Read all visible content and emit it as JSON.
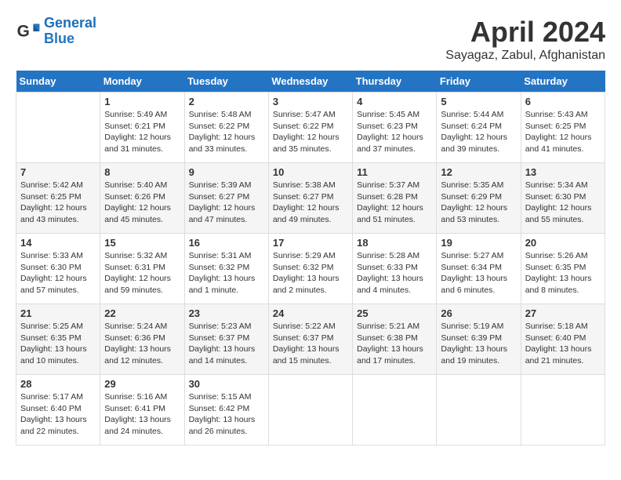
{
  "header": {
    "logo_line1": "General",
    "logo_line2": "Blue",
    "month_year": "April 2024",
    "location": "Sayagaz, Zabul, Afghanistan"
  },
  "weekdays": [
    "Sunday",
    "Monday",
    "Tuesday",
    "Wednesday",
    "Thursday",
    "Friday",
    "Saturday"
  ],
  "weeks": [
    [
      {
        "day": "",
        "info": ""
      },
      {
        "day": "1",
        "info": "Sunrise: 5:49 AM\nSunset: 6:21 PM\nDaylight: 12 hours\nand 31 minutes."
      },
      {
        "day": "2",
        "info": "Sunrise: 5:48 AM\nSunset: 6:22 PM\nDaylight: 12 hours\nand 33 minutes."
      },
      {
        "day": "3",
        "info": "Sunrise: 5:47 AM\nSunset: 6:22 PM\nDaylight: 12 hours\nand 35 minutes."
      },
      {
        "day": "4",
        "info": "Sunrise: 5:45 AM\nSunset: 6:23 PM\nDaylight: 12 hours\nand 37 minutes."
      },
      {
        "day": "5",
        "info": "Sunrise: 5:44 AM\nSunset: 6:24 PM\nDaylight: 12 hours\nand 39 minutes."
      },
      {
        "day": "6",
        "info": "Sunrise: 5:43 AM\nSunset: 6:25 PM\nDaylight: 12 hours\nand 41 minutes."
      }
    ],
    [
      {
        "day": "7",
        "info": "Sunrise: 5:42 AM\nSunset: 6:25 PM\nDaylight: 12 hours\nand 43 minutes."
      },
      {
        "day": "8",
        "info": "Sunrise: 5:40 AM\nSunset: 6:26 PM\nDaylight: 12 hours\nand 45 minutes."
      },
      {
        "day": "9",
        "info": "Sunrise: 5:39 AM\nSunset: 6:27 PM\nDaylight: 12 hours\nand 47 minutes."
      },
      {
        "day": "10",
        "info": "Sunrise: 5:38 AM\nSunset: 6:27 PM\nDaylight: 12 hours\nand 49 minutes."
      },
      {
        "day": "11",
        "info": "Sunrise: 5:37 AM\nSunset: 6:28 PM\nDaylight: 12 hours\nand 51 minutes."
      },
      {
        "day": "12",
        "info": "Sunrise: 5:35 AM\nSunset: 6:29 PM\nDaylight: 12 hours\nand 53 minutes."
      },
      {
        "day": "13",
        "info": "Sunrise: 5:34 AM\nSunset: 6:30 PM\nDaylight: 12 hours\nand 55 minutes."
      }
    ],
    [
      {
        "day": "14",
        "info": "Sunrise: 5:33 AM\nSunset: 6:30 PM\nDaylight: 12 hours\nand 57 minutes."
      },
      {
        "day": "15",
        "info": "Sunrise: 5:32 AM\nSunset: 6:31 PM\nDaylight: 12 hours\nand 59 minutes."
      },
      {
        "day": "16",
        "info": "Sunrise: 5:31 AM\nSunset: 6:32 PM\nDaylight: 13 hours\nand 1 minute."
      },
      {
        "day": "17",
        "info": "Sunrise: 5:29 AM\nSunset: 6:32 PM\nDaylight: 13 hours\nand 2 minutes."
      },
      {
        "day": "18",
        "info": "Sunrise: 5:28 AM\nSunset: 6:33 PM\nDaylight: 13 hours\nand 4 minutes."
      },
      {
        "day": "19",
        "info": "Sunrise: 5:27 AM\nSunset: 6:34 PM\nDaylight: 13 hours\nand 6 minutes."
      },
      {
        "day": "20",
        "info": "Sunrise: 5:26 AM\nSunset: 6:35 PM\nDaylight: 13 hours\nand 8 minutes."
      }
    ],
    [
      {
        "day": "21",
        "info": "Sunrise: 5:25 AM\nSunset: 6:35 PM\nDaylight: 13 hours\nand 10 minutes."
      },
      {
        "day": "22",
        "info": "Sunrise: 5:24 AM\nSunset: 6:36 PM\nDaylight: 13 hours\nand 12 minutes."
      },
      {
        "day": "23",
        "info": "Sunrise: 5:23 AM\nSunset: 6:37 PM\nDaylight: 13 hours\nand 14 minutes."
      },
      {
        "day": "24",
        "info": "Sunrise: 5:22 AM\nSunset: 6:37 PM\nDaylight: 13 hours\nand 15 minutes."
      },
      {
        "day": "25",
        "info": "Sunrise: 5:21 AM\nSunset: 6:38 PM\nDaylight: 13 hours\nand 17 minutes."
      },
      {
        "day": "26",
        "info": "Sunrise: 5:19 AM\nSunset: 6:39 PM\nDaylight: 13 hours\nand 19 minutes."
      },
      {
        "day": "27",
        "info": "Sunrise: 5:18 AM\nSunset: 6:40 PM\nDaylight: 13 hours\nand 21 minutes."
      }
    ],
    [
      {
        "day": "28",
        "info": "Sunrise: 5:17 AM\nSunset: 6:40 PM\nDaylight: 13 hours\nand 22 minutes."
      },
      {
        "day": "29",
        "info": "Sunrise: 5:16 AM\nSunset: 6:41 PM\nDaylight: 13 hours\nand 24 minutes."
      },
      {
        "day": "30",
        "info": "Sunrise: 5:15 AM\nSunset: 6:42 PM\nDaylight: 13 hours\nand 26 minutes."
      },
      {
        "day": "",
        "info": ""
      },
      {
        "day": "",
        "info": ""
      },
      {
        "day": "",
        "info": ""
      },
      {
        "day": "",
        "info": ""
      }
    ]
  ]
}
